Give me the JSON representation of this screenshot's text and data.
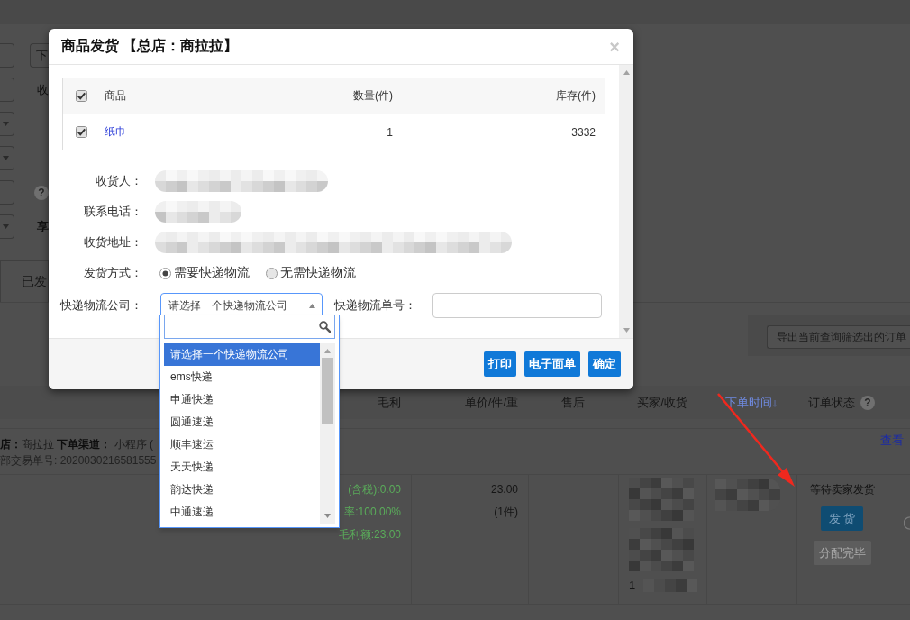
{
  "page": {
    "filters": [
      {
        "kind": "input",
        "side": {
          "kind": "button",
          "text": "下"
        }
      },
      {
        "kind": "input",
        "side": {
          "kind": "label",
          "text": "收"
        }
      },
      {
        "kind": "select"
      },
      {
        "kind": "select"
      },
      {
        "kind": "input",
        "side": {
          "kind": "help",
          "text": "?"
        }
      },
      {
        "kind": "select",
        "side": {
          "kind": "label",
          "text": "享"
        }
      }
    ],
    "tabs": [
      {
        "label": "已发",
        "selected": false
      }
    ],
    "export_button": "导出当前查询筛选出的订单",
    "columns": [
      {
        "label": "毛利",
        "kind": "text"
      },
      {
        "label": "单价/件/重",
        "kind": "text"
      },
      {
        "label": "售后",
        "kind": "text"
      },
      {
        "label": "买家/收货",
        "kind": "text"
      },
      {
        "label": "下单时间↓",
        "kind": "sort"
      },
      {
        "label": "订单状态",
        "kind": "help",
        "help": "?"
      }
    ],
    "order": {
      "info": "**店：**商拉拉 **下单渠道：** 小程序 (",
      "trade_no": "部交易单号: 2020030216581555",
      "detail_link": "查看",
      "profit_lines": [
        "(含税):0.00",
        "率:100.00%",
        "毛利额:23.00"
      ],
      "unit_price": "23.00",
      "quantity": "(1件)",
      "buyer_fragment": "1",
      "status": "等待卖家发货",
      "actions": [
        {
          "label": "发 货",
          "kind": "primary"
        },
        {
          "label": "分配完毕",
          "kind": "secondary"
        }
      ]
    }
  },
  "dialog": {
    "title": "商品发货 【总店：商拉拉】",
    "close": "×",
    "table": {
      "header_checked": true,
      "columns": [
        "商品",
        "数量(件)",
        "库存(件)"
      ],
      "rows": [
        {
          "checked": true,
          "product": "纸巾",
          "quantity": "1",
          "stock": "3332"
        }
      ]
    },
    "fields": [
      {
        "label": "收货人：",
        "redacted": true
      },
      {
        "label": "联系电话：",
        "redacted": true
      },
      {
        "label": "收货地址：",
        "redacted": true
      }
    ],
    "shipping": {
      "label": "发货方式：",
      "options": [
        {
          "label": "需要快递物流",
          "selected": true
        },
        {
          "label": "无需快递物流",
          "selected": false
        }
      ]
    },
    "courier": {
      "label": "快递物流公司：",
      "value": "请选择一个快递物流公司",
      "expanded": true
    },
    "tracking": {
      "label": "快递物流单号："
    },
    "buttons": [
      "打印",
      "电子面单",
      "确定"
    ]
  },
  "dropdown": {
    "options": [
      {
        "label": "请选择一个快递物流公司",
        "selected": true
      },
      {
        "label": "ems快递",
        "selected": false
      },
      {
        "label": "申通快递",
        "selected": false
      },
      {
        "label": "圆通速递",
        "selected": false
      },
      {
        "label": "顺丰速运",
        "selected": false
      },
      {
        "label": "天天快递",
        "selected": false
      },
      {
        "label": "韵达快递",
        "selected": false
      },
      {
        "label": "中通速递",
        "selected": false
      }
    ]
  }
}
